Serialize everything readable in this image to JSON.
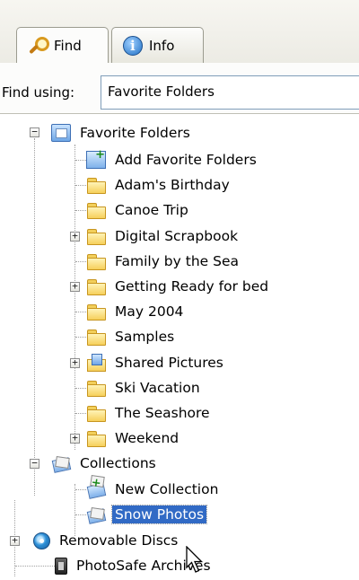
{
  "tabs": [
    {
      "label": "Find",
      "icon": "magnifier-icon",
      "active": true
    },
    {
      "label": "Info",
      "icon": "info-icon",
      "active": false
    }
  ],
  "find_using": {
    "label": "Find using:",
    "value": "Favorite Folders"
  },
  "tree": {
    "favorites": {
      "label": "Favorite Folders",
      "toggle": "−",
      "children": [
        "Add Favorite Folders",
        "Adam's Birthday",
        "Canoe Trip",
        "Digital Scrapbook",
        "Family by the Sea",
        "Getting Ready for bed",
        "May 2004",
        "Samples",
        "Shared Pictures",
        "Ski Vacation",
        "The Seashore",
        "Weekend"
      ]
    },
    "collections": {
      "label": "Collections",
      "toggle": "−",
      "children": [
        "New Collection",
        "Snow Photos"
      ]
    },
    "removable": {
      "label": "Removable Discs",
      "toggle": "+"
    },
    "photosafe": {
      "label": "PhotoSafe Archives"
    }
  },
  "colors": {
    "selection": "#316ac5",
    "tab_border": "#9b9b8f"
  }
}
